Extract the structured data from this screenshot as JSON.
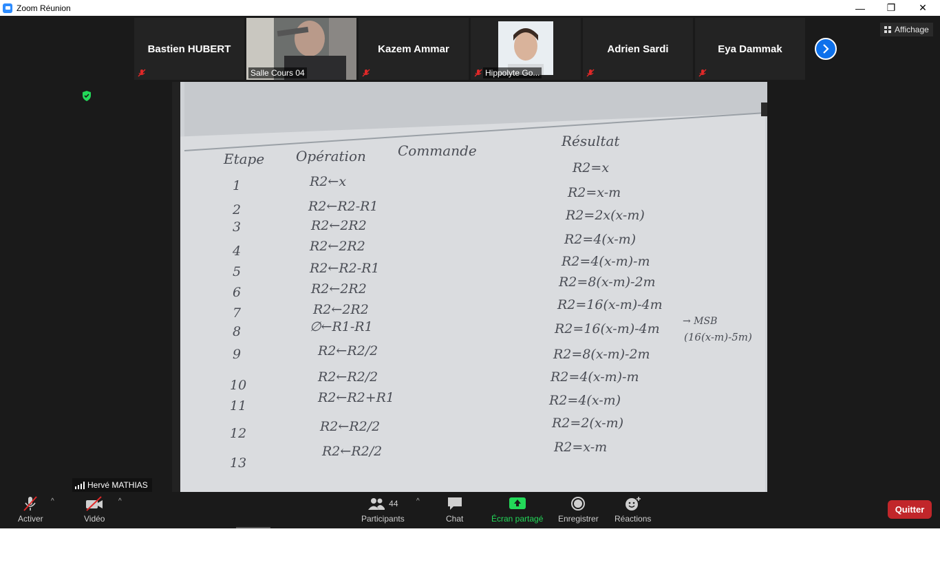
{
  "window": {
    "title": "Zoom Réunion",
    "minimize": "—",
    "restore": "❐",
    "close": "✕"
  },
  "participants_strip": [
    {
      "name": "Bastien HUBERT",
      "video": false,
      "muted": true
    },
    {
      "name": "Salle Cours 04",
      "video": true,
      "muted": false
    },
    {
      "name": "Kazem Ammar",
      "video": false,
      "muted": true
    },
    {
      "name": "Hippolyte Go...",
      "video": true,
      "muted": true
    },
    {
      "name": "Adrien Sardi",
      "video": false,
      "muted": true
    },
    {
      "name": "Eya Dammak",
      "video": false,
      "muted": true
    }
  ],
  "view_button": "Affichage",
  "next_page_icon": "chevron-right-icon",
  "speaker_name": "Hervé MATHIAS",
  "board": {
    "headers": [
      "Etape",
      "Opération",
      "Commande",
      "Résultat"
    ],
    "steps": [
      "1",
      "2",
      "3",
      "4",
      "5",
      "6",
      "7",
      "8",
      "9",
      "10",
      "11",
      "12",
      "13"
    ],
    "operations": [
      "R2←x",
      "R2←R2-R1",
      "R2←2R2",
      "R2←2R2",
      "R2←R2-R1",
      "R2←2R2",
      "R2←2R2",
      "∅←R1-R1",
      "R2←R2/2",
      "R2←R2/2",
      "R2←R2+R1",
      "R2←R2/2",
      "R2←R2/2"
    ],
    "results": [
      "R2=x",
      "R2=x-m",
      "R2=2x(x-m)",
      "R2=4(x-m)",
      "R2=4(x-m)-m",
      "R2=8(x-m)-2m",
      "R2=16(x-m)-4m",
      "R2=16(x-m)-4m",
      "R2=8(x-m)-2m",
      "R2=4(x-m)-m",
      "R2=4(x-m)",
      "R2=2(x-m)",
      "R2=x-m"
    ],
    "note_top": "→ MSB",
    "note_bottom": "(16(x-m)-5m)"
  },
  "toolbar": {
    "mute": "Activer",
    "video": "Vidéo",
    "participants": "Participants",
    "participants_count": "44",
    "chat": "Chat",
    "share": "Écran partagé",
    "record": "Enregistrer",
    "reactions": "Réactions",
    "quit": "Quitter"
  },
  "colors": {
    "accent": "#0e71eb",
    "share_green": "#23d959",
    "quit_red": "#c1262a",
    "muted_red": "#e02828"
  }
}
